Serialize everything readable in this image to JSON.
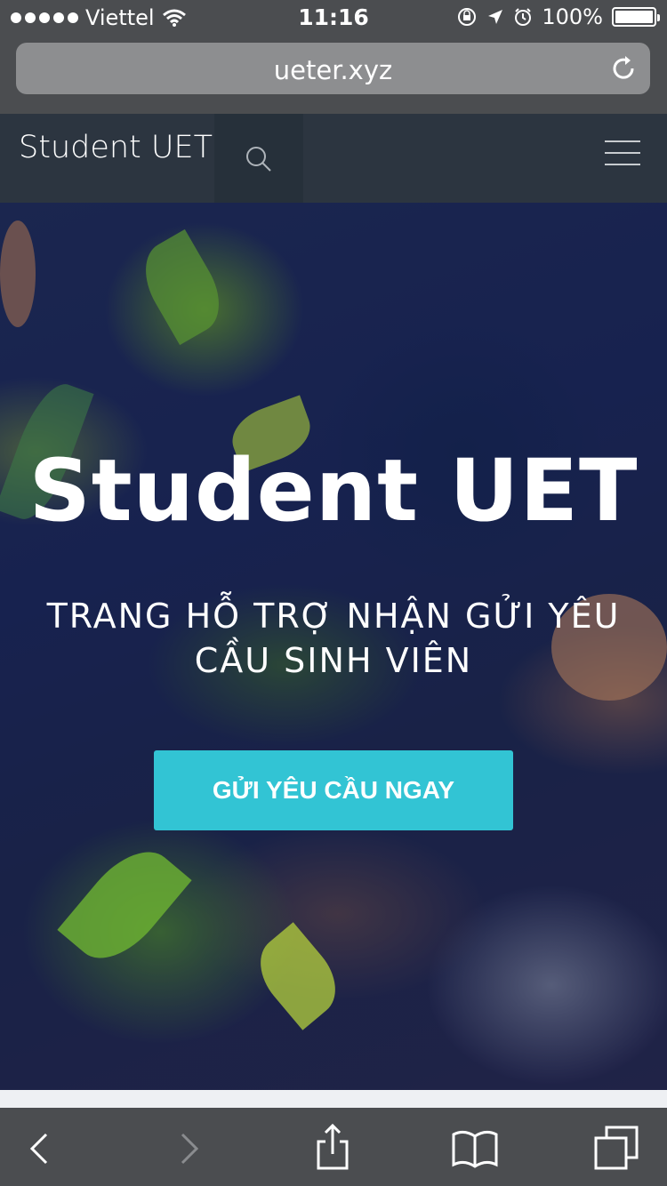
{
  "status_bar": {
    "carrier": "Viettel",
    "time": "11:16",
    "battery_percent": "100%",
    "battery_level": 1.0,
    "icons": [
      "wifi-icon",
      "rotation-lock-icon",
      "location-icon",
      "alarm-icon",
      "battery-icon"
    ]
  },
  "browser": {
    "url": "ueter.xyz",
    "reload_icon": "reload-icon"
  },
  "navbar": {
    "brand": "Student UET",
    "search_icon": "search-icon",
    "menu_icon": "hamburger-menu-icon"
  },
  "hero": {
    "title": "Student UET",
    "subtitle": "TRANG HỖ TRỢ NHẬN GỬI YÊU CẦU SINH VIÊN",
    "cta_label": "GỬI YÊU CẦU NGAY",
    "cta_color": "#32c4d4"
  },
  "toolbar": {
    "icons": [
      "back-icon",
      "forward-icon",
      "share-icon",
      "bookmarks-icon",
      "tabs-icon"
    ]
  }
}
